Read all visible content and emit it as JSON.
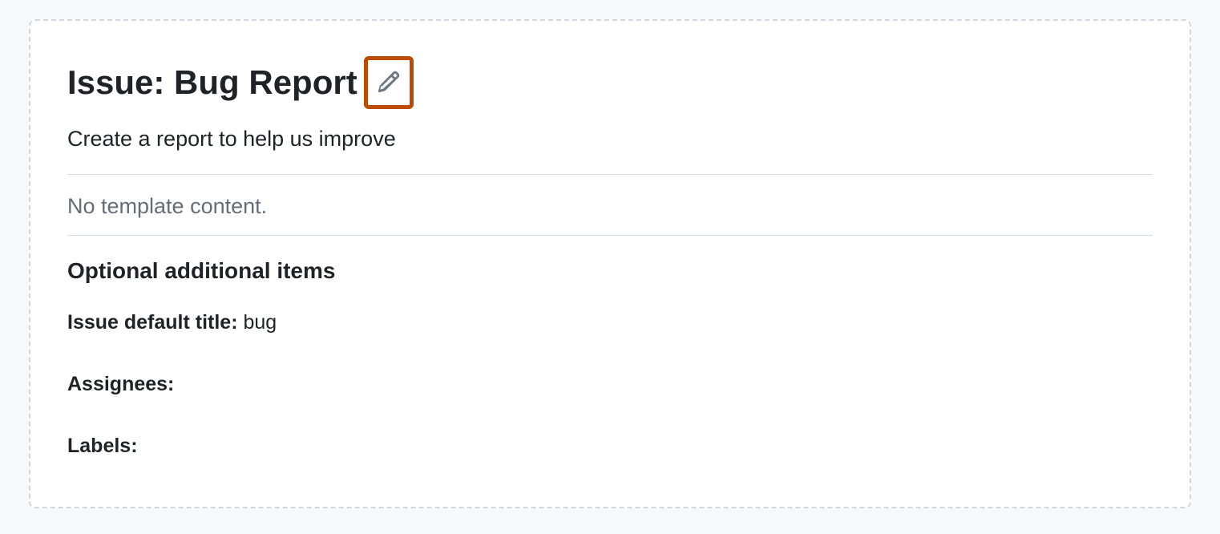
{
  "header": {
    "title": "Issue: Bug Report",
    "subtitle": "Create a report to help us improve"
  },
  "body": {
    "empty_message": "No template content."
  },
  "optional": {
    "heading": "Optional additional items",
    "default_title_label": "Issue default title:",
    "default_title_value": "bug",
    "assignees_label": "Assignees:",
    "assignees_value": "",
    "labels_label": "Labels:",
    "labels_value": ""
  }
}
